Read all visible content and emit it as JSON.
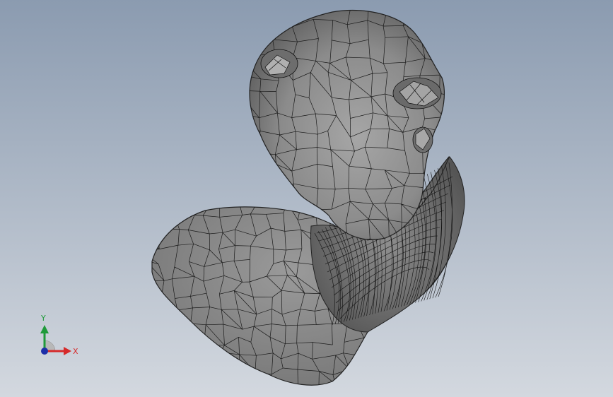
{
  "viewport": {
    "background_top": "#8b9bb0",
    "background_bottom": "#d3d8df",
    "model_fill": "#8a8a8a",
    "mesh_line": "#1a1a1a"
  },
  "triad": {
    "x_label": "X",
    "y_label": "Y",
    "x_color": "#d62a2a",
    "y_color": "#1f9a3a",
    "z_color": "#1d2fa8"
  }
}
